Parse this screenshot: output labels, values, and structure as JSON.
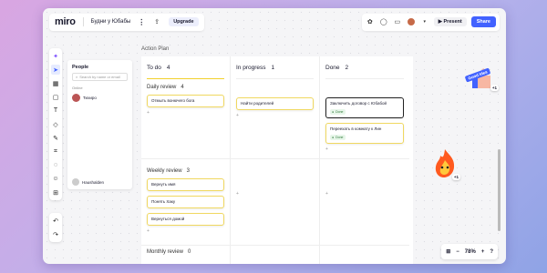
{
  "app": {
    "logo": "miro",
    "board_name": "Будни у Юбабы",
    "upgrade_label": "Upgrade",
    "present_label": "Present",
    "share_label": "Share"
  },
  "people_panel": {
    "title": "People",
    "search_placeholder": "Search by name or email",
    "online_label": "Online",
    "online_user": "Тихиро",
    "current_user": "Haushalden"
  },
  "board": {
    "title": "Action Plan",
    "columns": [
      {
        "label": "To do",
        "count": "4",
        "accent": "#f2d12c"
      },
      {
        "label": "In progress",
        "count": "1",
        "accent": "#eeeeee"
      },
      {
        "label": "Done",
        "count": "2",
        "accent": "#eeeeee"
      }
    ],
    "rows": [
      {
        "label": "Daily review",
        "count": "4"
      },
      {
        "label": "Weekly review",
        "count": "3"
      },
      {
        "label": "Monthly review",
        "count": "0"
      }
    ],
    "cards": {
      "todo_daily": [
        "Отмыть вонючего бога"
      ],
      "inprogress_daily": [
        "Найти родителей"
      ],
      "done_daily": [
        "Заключить договор с Юбабой",
        "Переехать в комнату к Лин"
      ],
      "todo_weekly": [
        "Вернуть имя",
        "Понять Хаку",
        "Вернуться домой"
      ]
    },
    "done_tag": "Done"
  },
  "stickers": {
    "good_idea": "Good Idea",
    "badge_1": "+1",
    "badge_2": "+1"
  },
  "zoom": {
    "level": "78%"
  }
}
